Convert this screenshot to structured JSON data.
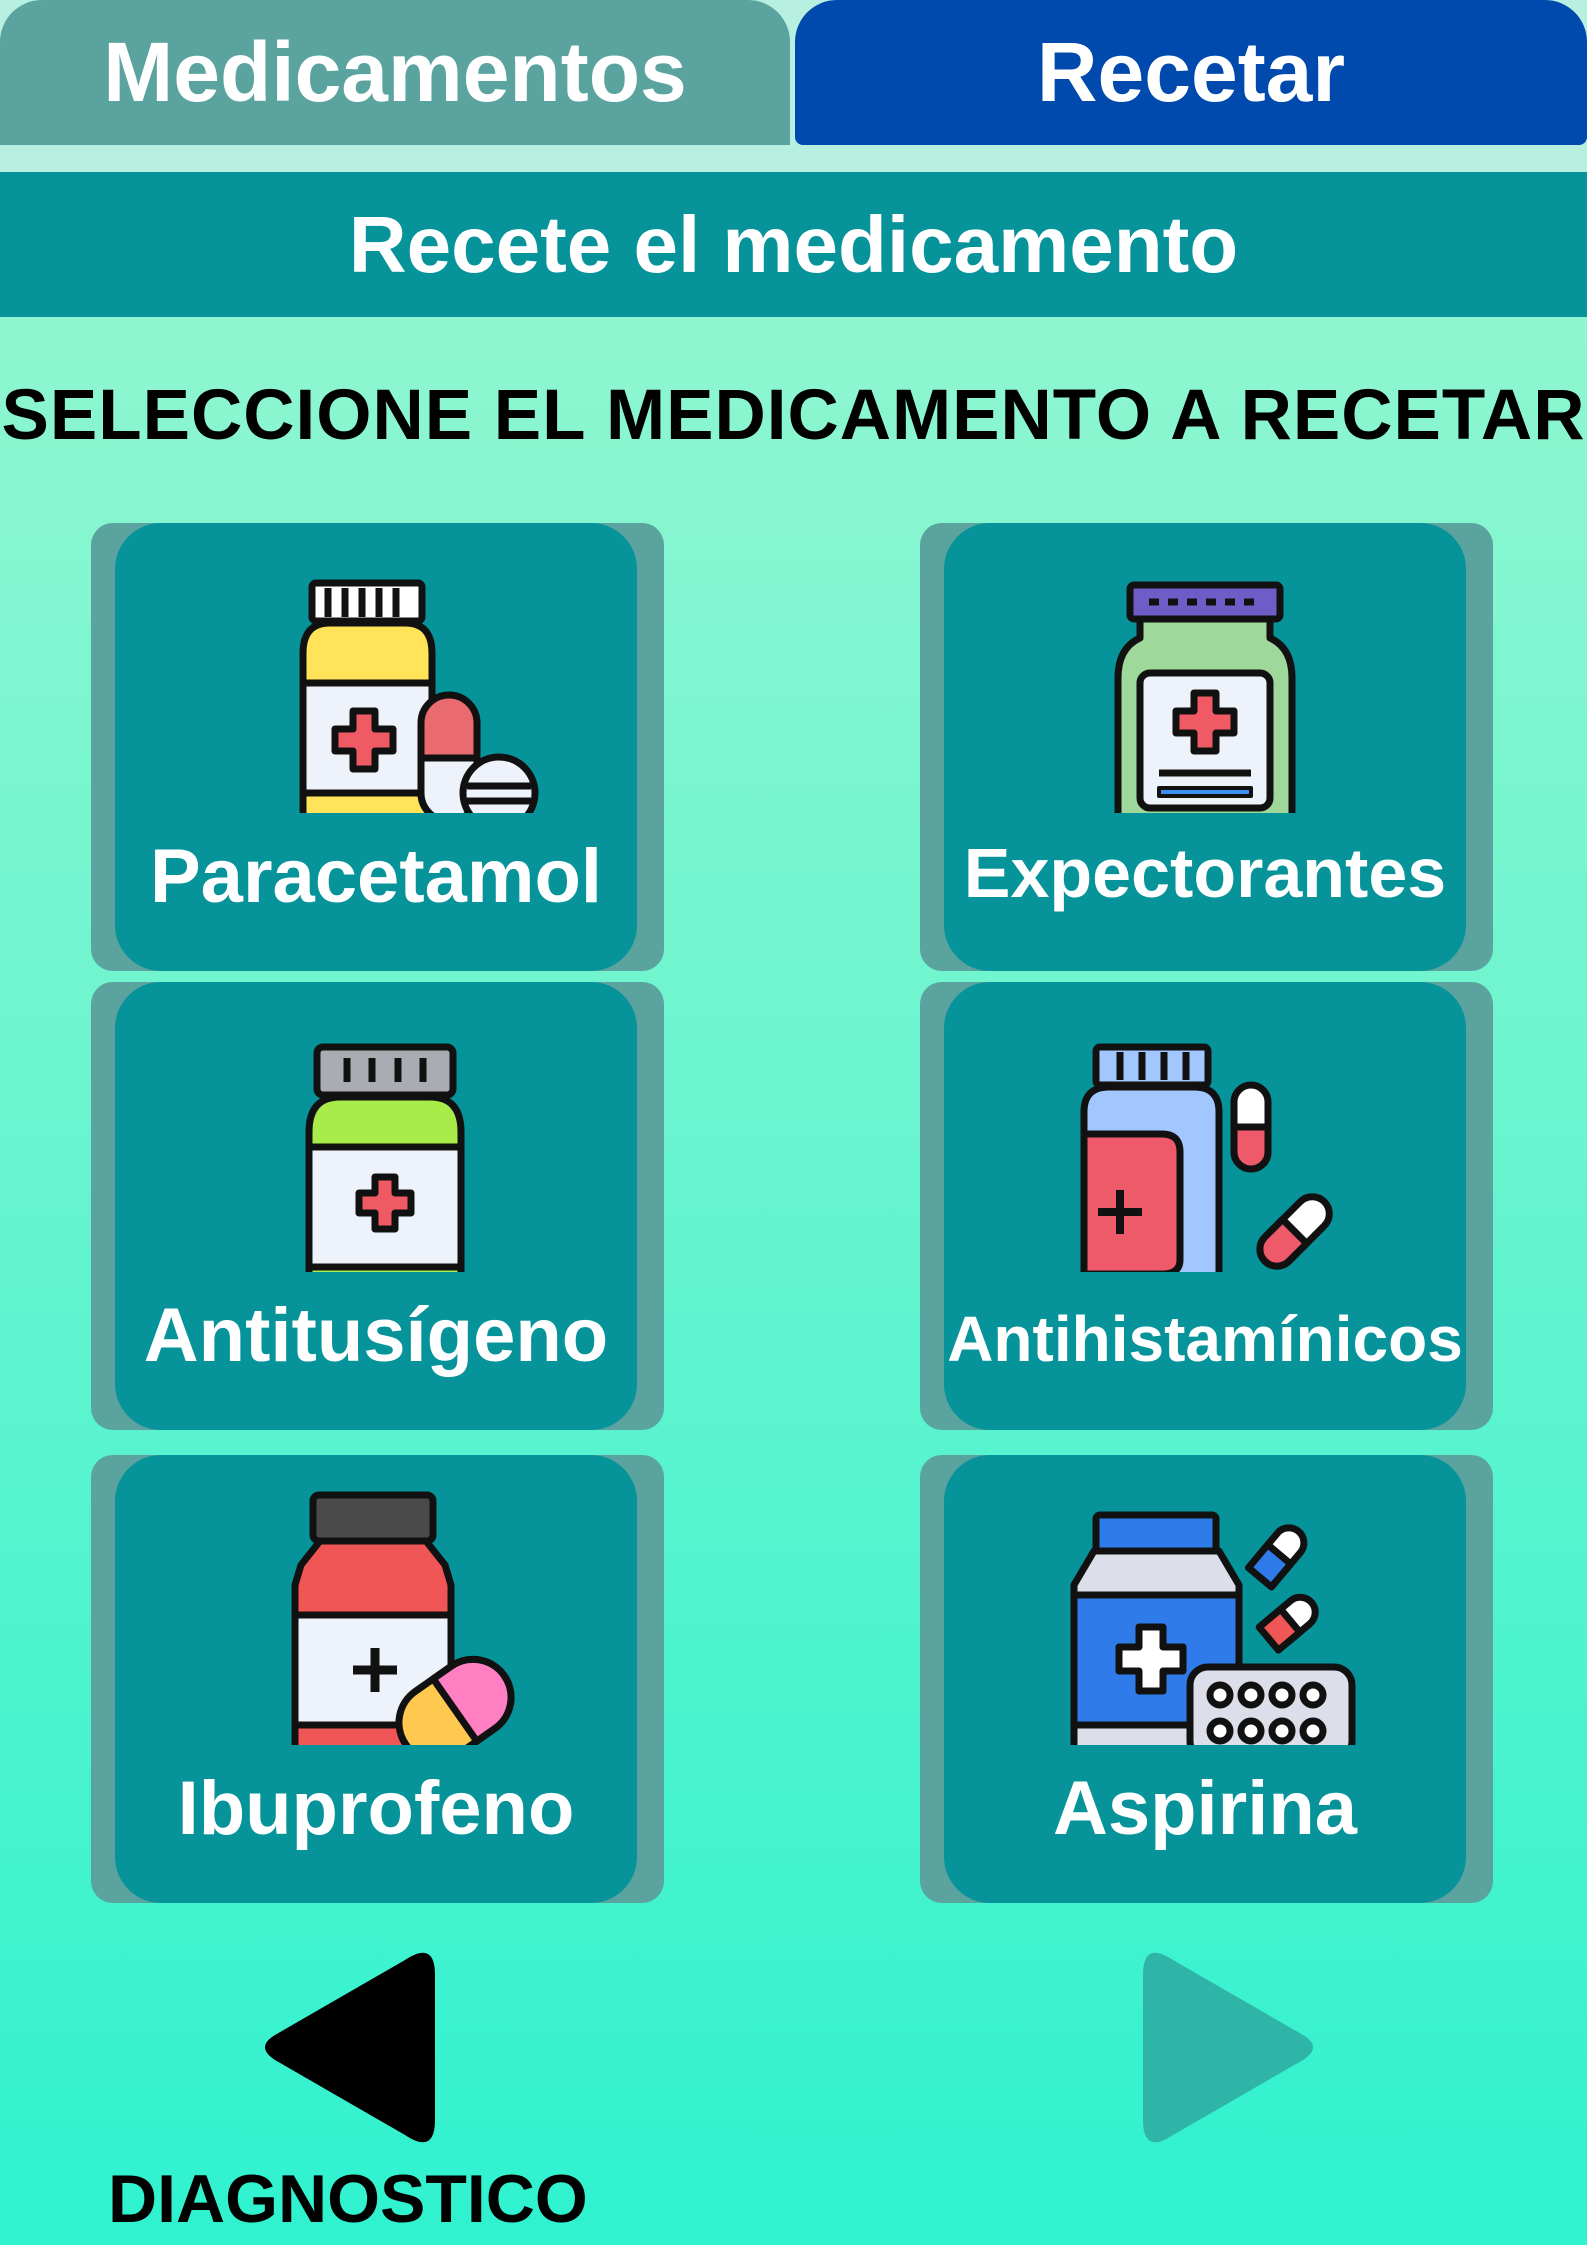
{
  "tabs": {
    "medicamentos": "Medicamentos",
    "recetar": "Recetar"
  },
  "header": {
    "title": "Recete el medicamento"
  },
  "instruction": "SELECCIONE EL MEDICAMENTO A RECETAR",
  "medications": [
    {
      "label": "Paracetamol",
      "icon": "pill-bottle-yellow-icon"
    },
    {
      "label": "Expectorantes",
      "icon": "syrup-bottle-icon"
    },
    {
      "label": "Antitusígeno",
      "icon": "pill-bottle-green-icon"
    },
    {
      "label": "Antihistamínicos",
      "icon": "pill-bottle-blue-icon"
    },
    {
      "label": "Ibuprofeno",
      "icon": "pill-bottle-red-icon"
    },
    {
      "label": "Aspirina",
      "icon": "pill-bottle-blister-icon"
    }
  ],
  "nav": {
    "back_label": "DIAGNOSTICO"
  },
  "colors": {
    "tab_inactive": "#5aa39f",
    "tab_active": "#0049ad",
    "header_bar": "#07939a",
    "card": "#07939a",
    "card_shadow": "#5aa39f",
    "next_arrow_disabled": "#2fb5a8"
  }
}
